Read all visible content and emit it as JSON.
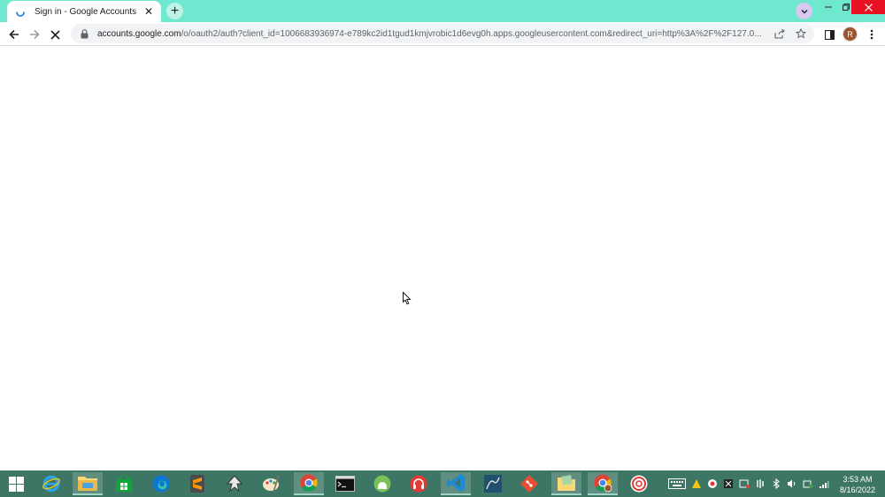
{
  "browser": {
    "tab": {
      "title": "Sign in - Google Accounts",
      "close_icon": "close-icon",
      "loading_icon": "spinner-icon"
    },
    "new_tab_icon": "plus-icon",
    "tab_search_icon": "chevron-down-icon",
    "window_controls": {
      "minimize": "minimize-icon",
      "restore": "restore-icon",
      "close": "close-icon"
    },
    "toolbar": {
      "back_icon": "back-arrow-icon",
      "forward_icon": "forward-arrow-icon",
      "stop_icon": "stop-loading-icon",
      "url_host": "accounts.google.com",
      "url_path": "/o/oauth2/auth?client_id=1006683936974-e789kc2id1tgud1kmjvrobic1d6evg0h.apps.googleusercontent.com&redirect_uri=http%3A%2F%2F127.0...",
      "share_icon": "share-icon",
      "bookmark_icon": "star-icon",
      "side_panel_icon": "side-panel-icon",
      "profile_initial": "R",
      "menu_icon": "kebab-menu-icon"
    }
  },
  "taskbar": {
    "start_icon": "windows-start-icon",
    "apps": [
      {
        "name": "internet-explorer-icon"
      },
      {
        "name": "file-explorer-icon"
      },
      {
        "name": "store-icon"
      },
      {
        "name": "edge-icon"
      },
      {
        "name": "sublime-text-icon"
      },
      {
        "name": "inkscape-icon"
      },
      {
        "name": "paint-icon"
      },
      {
        "name": "chrome-icon"
      },
      {
        "name": "terminal-icon"
      },
      {
        "name": "android-studio-icon"
      },
      {
        "name": "audio-app-icon"
      },
      {
        "name": "vscode-icon"
      },
      {
        "name": "mysql-workbench-icon"
      },
      {
        "name": "git-icon"
      },
      {
        "name": "notes-icon"
      },
      {
        "name": "chrome-profile-icon"
      },
      {
        "name": "circle-app-icon"
      }
    ],
    "tray": {
      "keyboard_icon": "keyboard-icon",
      "time": "3:53 AM",
      "date": "8/16/2022"
    }
  }
}
